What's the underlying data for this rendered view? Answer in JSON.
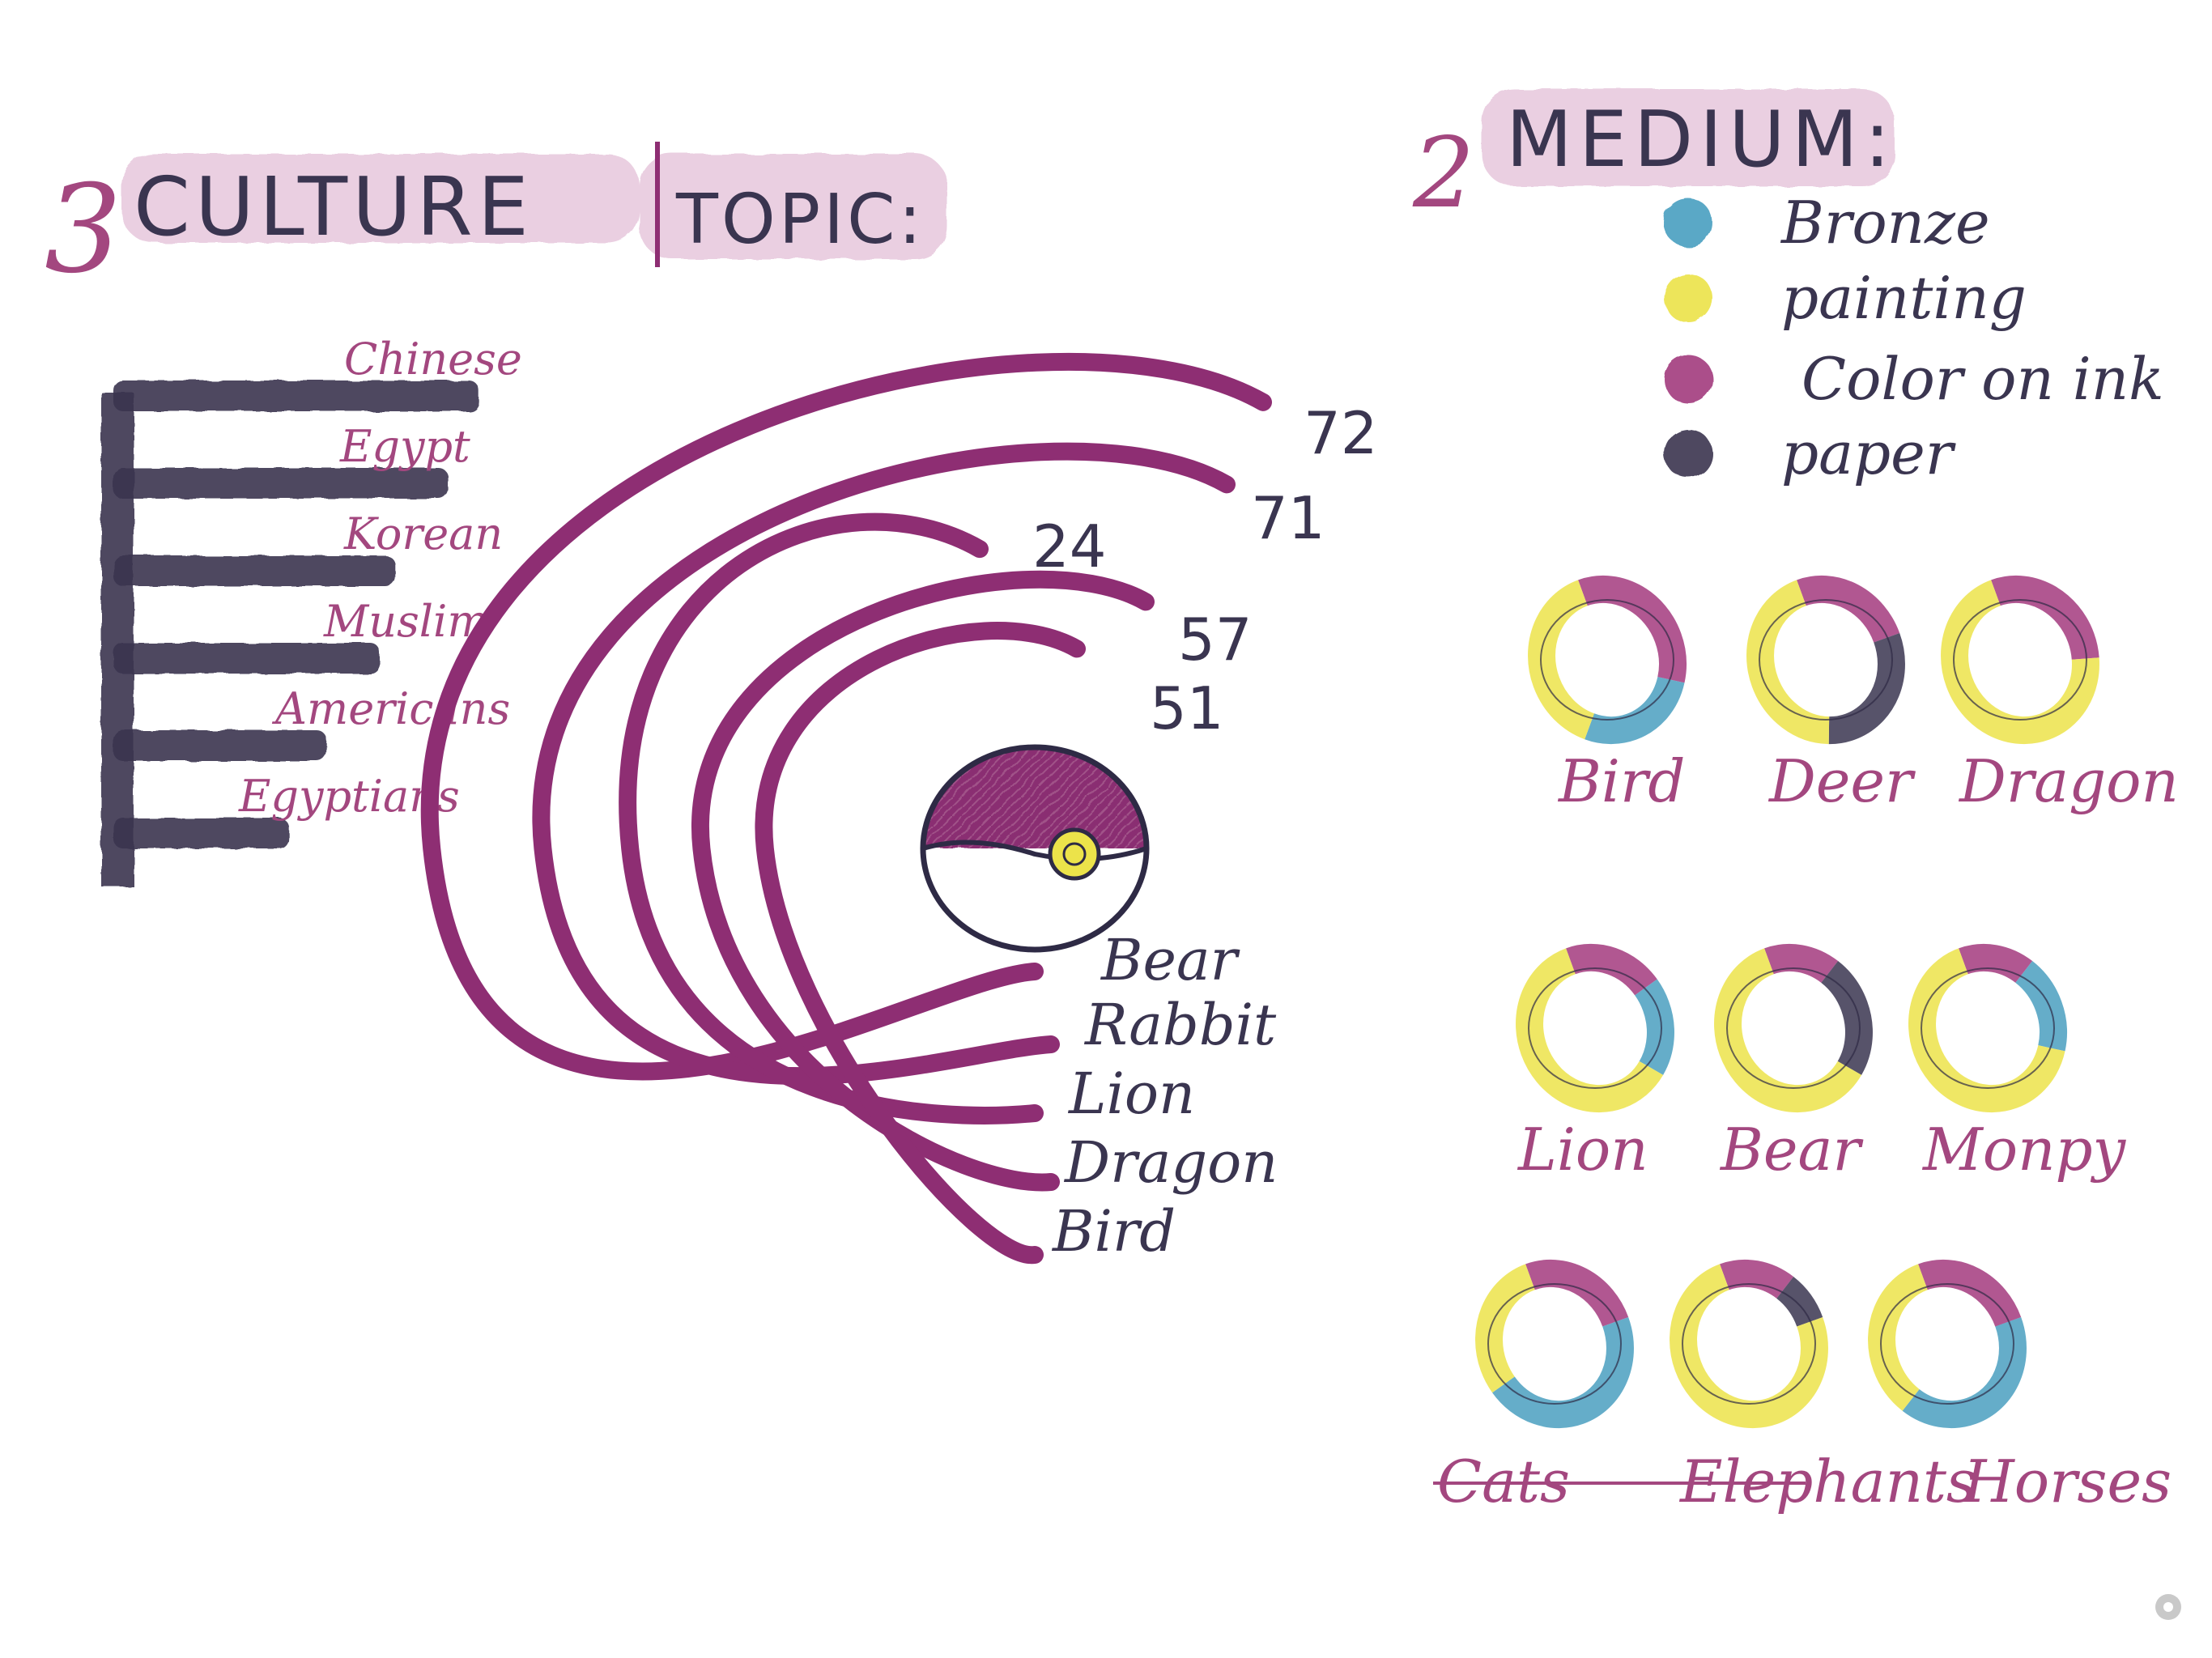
{
  "colors": {
    "purple": "#8e2e73",
    "dark": "#3a3550",
    "pink_text": "#a3477f",
    "highlight": "#e6c4da",
    "bronze": "#4a9fc0",
    "painting": "#ece34a",
    "color_on_ink": "#a33a7e",
    "paper": "#3a3550"
  },
  "headers": {
    "culture_num": "3",
    "culture": "CULTURE",
    "topic": "TOPIC:",
    "medium_num": "2",
    "medium": "MEDIUM:"
  },
  "chart_data": [
    {
      "type": "bar",
      "orientation": "horizontal",
      "categories": [
        "Chinese",
        "Egypt",
        "Korean",
        "Muslim",
        "Americans",
        "Egyptians"
      ],
      "values": [
        480,
        440,
        370,
        350,
        280,
        230
      ],
      "xlim": [
        0,
        500
      ]
    },
    {
      "type": "radial-bar",
      "categories": [
        "Bird",
        "Dragon",
        "Lion",
        "Rabbit",
        "Bear",
        "Pokeball"
      ],
      "series": [
        {
          "values": [
            72,
            71,
            24,
            57,
            51
          ]
        }
      ],
      "data_labels": [
        "72",
        "71",
        "24",
        "57",
        "51"
      ],
      "arc_labels": [
        "Bear",
        "Rabbit",
        "Lion",
        "Dragon",
        "Bird"
      ]
    },
    {
      "type": "pie",
      "legend": [
        {
          "label": "Bronze",
          "color": "#4a9fc0"
        },
        {
          "label": "painting",
          "color": "#ece34a"
        },
        {
          "label": "Color on ink",
          "color": "#a33a7e"
        },
        {
          "label": "paper",
          "color": "#3a3550"
        }
      ],
      "rings": [
        {
          "label": "Bird",
          "segments": [
            {
              "m": "Color on ink",
              "f": 0.35
            },
            {
              "m": "Bronze",
              "f": 0.25
            },
            {
              "m": "painting",
              "f": 0.4
            }
          ]
        },
        {
          "label": "Deer",
          "segments": [
            {
              "m": "Color on ink",
              "f": 0.25
            },
            {
              "m": "paper",
              "f": 0.3
            },
            {
              "m": "painting",
              "f": 0.45
            }
          ]
        },
        {
          "label": "Dragon",
          "segments": [
            {
              "m": "Color on ink",
              "f": 0.3
            },
            {
              "m": "painting",
              "f": 0.7
            }
          ]
        },
        {
          "label": "Lion",
          "segments": [
            {
              "m": "Color on ink",
              "f": 0.2
            },
            {
              "m": "Bronze",
              "f": 0.2
            },
            {
              "m": "painting",
              "f": 0.6
            }
          ]
        },
        {
          "label": "Bear",
          "segments": [
            {
              "m": "Color on ink",
              "f": 0.15
            },
            {
              "m": "paper",
              "f": 0.25
            },
            {
              "m": "painting",
              "f": 0.6
            }
          ]
        },
        {
          "label": "Monpy",
          "segments": [
            {
              "m": "Color on ink",
              "f": 0.15
            },
            {
              "m": "Bronze",
              "f": 0.2
            },
            {
              "m": "painting",
              "f": 0.65
            }
          ]
        },
        {
          "label": "Cats",
          "segments": [
            {
              "m": "Color on ink",
              "f": 0.25
            },
            {
              "m": "Bronze",
              "f": 0.45
            },
            {
              "m": "painting",
              "f": 0.3
            }
          ]
        },
        {
          "label": "Elephants",
          "segments": [
            {
              "m": "Color on ink",
              "f": 0.15
            },
            {
              "m": "paper",
              "f": 0.1
            },
            {
              "m": "painting",
              "f": 0.75
            }
          ]
        },
        {
          "label": "Horses",
          "segments": [
            {
              "m": "Color on ink",
              "f": 0.25
            },
            {
              "m": "Bronze",
              "f": 0.4
            },
            {
              "m": "painting",
              "f": 0.35
            }
          ]
        }
      ]
    }
  ]
}
